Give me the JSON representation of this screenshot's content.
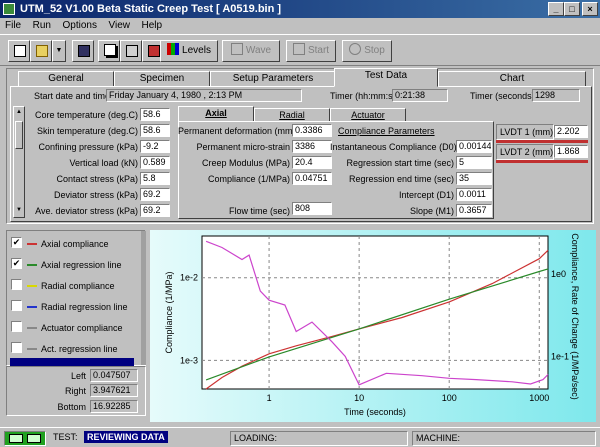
{
  "window": {
    "title": "UTM_52  V1.00 Beta  Static Creep Test [ A0519.bin ]",
    "minimize": "_",
    "maximize": "□",
    "close": "×"
  },
  "menu": [
    "File",
    "Run",
    "Options",
    "View",
    "Help"
  ],
  "toolbar": {
    "levels": "Levels",
    "wave": "Wave",
    "start": "Start",
    "stop": "Stop"
  },
  "tabs": [
    "General",
    "Specimen",
    "Setup Parameters",
    "Test Data",
    "Chart"
  ],
  "header": {
    "start_label": "Start date and time",
    "start_value": "Friday January 4, 1980 , 2:13 PM",
    "timer_label": "Timer (hh:mm:ss)",
    "timer_value": "0:21:38",
    "timer_sec_label": "Timer (seconds)",
    "timer_sec_value": "1298"
  },
  "left_fields": [
    {
      "label": "Core temperature (deg.C)",
      "value": "58.6"
    },
    {
      "label": "Skin temperature (deg.C)",
      "value": "58.6"
    },
    {
      "label": "Confining pressure (kPa)",
      "value": "-9.2"
    },
    {
      "label": "Vertical load (kN)",
      "value": "0.589"
    },
    {
      "label": "Contact stress (kPa)",
      "value": "5.8"
    },
    {
      "label": "Deviator stress (kPa)",
      "value": "69.2"
    },
    {
      "label": "Ave. deviator stress (kPa)",
      "value": "69.2"
    }
  ],
  "subtabs": [
    "Axial",
    "Radial",
    "Actuator"
  ],
  "axial_fields": [
    {
      "label": "Permanent deformation (mm)",
      "value": "0.3386"
    },
    {
      "label": "Permanent micro-strain",
      "value": "3386"
    },
    {
      "label": "Creep Modulus (MPa)",
      "value": "20.4"
    },
    {
      "label": "Compliance (1/MPa)",
      "value": "0.04751"
    }
  ],
  "flow_time": {
    "label": "Flow time (sec)",
    "value": "808"
  },
  "compliance": {
    "title": "Compliance Parameters",
    "fields": [
      {
        "label": "Instantaneous Compliance (D0)",
        "value": "0.00144"
      },
      {
        "label": "Regression start time (sec)",
        "value": "5"
      },
      {
        "label": "Regression end time (sec)",
        "value": "35"
      },
      {
        "label": "Intercept (D1)",
        "value": "0.0011"
      },
      {
        "label": "Slope (M1)",
        "value": "0.3657"
      }
    ]
  },
  "lvdt": [
    {
      "label": "LVDT 1 (mm)",
      "value": "2.202"
    },
    {
      "label": "LVDT 2 (mm)",
      "value": "1.868"
    }
  ],
  "legend": [
    {
      "label": "Axial compliance",
      "checked": "✔",
      "color": "#cc3333"
    },
    {
      "label": "Axial regression line",
      "checked": "✔",
      "color": "#2a8a2a"
    },
    {
      "label": "Radial compliance",
      "checked": "",
      "color": "#d8d800"
    },
    {
      "label": "Radial regression line",
      "checked": "",
      "color": "#2233cc"
    },
    {
      "label": "Actuator compliance",
      "checked": "",
      "color": "#888888"
    },
    {
      "label": "Act. regression line",
      "checked": "",
      "color": "#888888"
    }
  ],
  "bounds": [
    {
      "label": "Left",
      "value": "0.047507"
    },
    {
      "label": "Right",
      "value": "3.947621"
    },
    {
      "label": "Bottom",
      "value": "16.92285"
    }
  ],
  "chart_data": {
    "type": "line",
    "title": "",
    "xlabel": "Time (seconds)",
    "ylabel": "Compliance (1/MPa)",
    "y2label": "Compliance, Rate of Change (1/MPa/sec)",
    "xscale": "log",
    "yscale": "log",
    "x_ticks": [
      "1",
      "10",
      "100",
      "1000"
    ],
    "y_ticks": [
      "1e-3",
      "1e-2"
    ],
    "y2_ticks": [
      "1e-1",
      "1e0"
    ],
    "xlim": [
      0.18,
      1250
    ],
    "ylim": [
      0.00045,
      0.032
    ],
    "y2lim": [
      0.04,
      2.9
    ],
    "grid": true,
    "series": [
      {
        "x": [
          0.2,
          0.3,
          0.5,
          1,
          2,
          5,
          10,
          30,
          100,
          300,
          1000,
          1250
        ],
        "values": [
          0.00044,
          0.00062,
          0.00085,
          0.0012,
          0.0015,
          0.00195,
          0.0024,
          0.0033,
          0.0051,
          0.0085,
          0.017,
          0.0215
        ]
      },
      {
        "x": [
          0.2,
          1,
          10,
          100,
          1000,
          1250
        ],
        "values": [
          0.00058,
          0.0011,
          0.0024,
          0.0055,
          0.0119,
          0.0128
        ]
      },
      {
        "axis": "y2",
        "x": [
          0.2,
          0.3,
          0.5,
          0.6,
          0.8,
          1,
          1.5,
          2,
          3,
          5,
          7,
          10,
          20,
          50,
          100,
          200,
          500,
          800,
          1100,
          1250
        ],
        "values": [
          2.5,
          2.1,
          1.5,
          1.7,
          0.62,
          0.48,
          0.42,
          0.2,
          0.26,
          0.15,
          0.1,
          0.045,
          0.062,
          0.058,
          0.054,
          0.052,
          0.049,
          0.046,
          0.052,
          0.06
        ]
      }
    ]
  },
  "status": {
    "test_label": "TEST:",
    "test_value": "REVIEWING DATA",
    "loading": "LOADING:",
    "machine": "MACHINE:"
  }
}
